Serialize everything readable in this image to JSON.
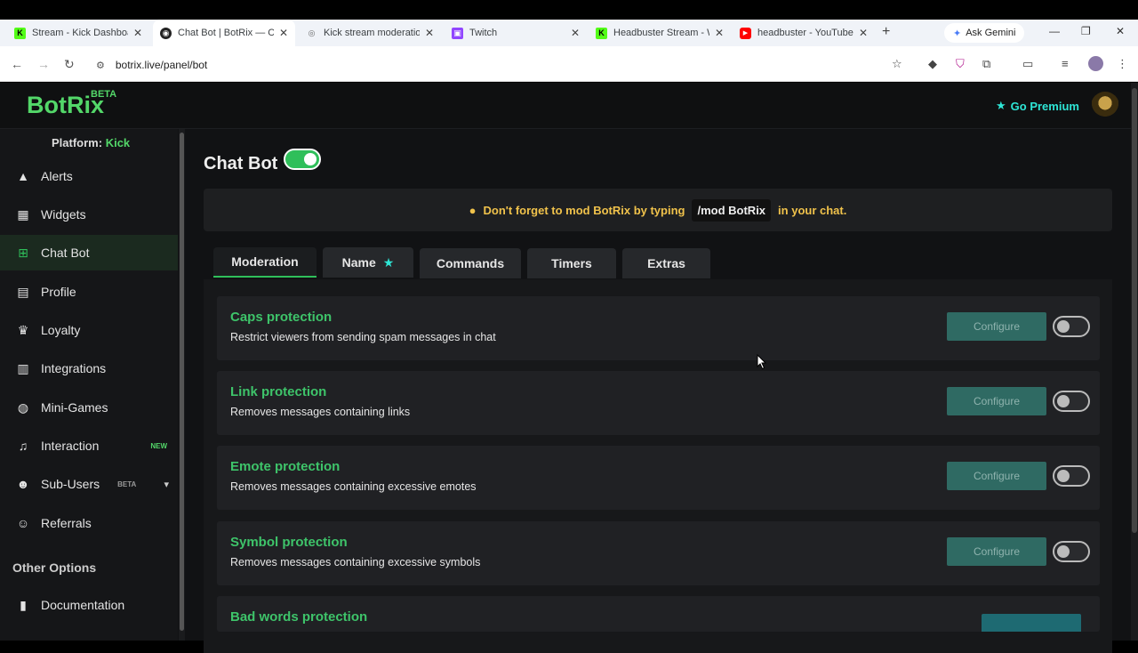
{
  "browser": {
    "tabs": [
      {
        "title": "Stream - Kick Dashboard",
        "icon": "kick-icon",
        "color": "#53fc18"
      },
      {
        "title": "Chat Bot | BotRix — Ch",
        "icon": "botrix-icon",
        "color": "#222222"
      },
      {
        "title": "Kick stream moderation",
        "icon": "globe-icon",
        "color": "#888888"
      },
      {
        "title": "Twitch",
        "icon": "twitch-icon",
        "color": "#9146ff"
      },
      {
        "title": "Headbuster Stream - W",
        "icon": "kick-icon",
        "color": "#53fc18"
      },
      {
        "title": "headbuster - YouTube",
        "icon": "youtube-icon",
        "color": "#ff0000"
      }
    ],
    "gemini_label": "Ask Gemini",
    "url": "botrix.live/panel/bot"
  },
  "header": {
    "logo": "BotRix",
    "logo_badge": "BETA",
    "premium_label": "Go Premium"
  },
  "sidebar": {
    "platform_label": "Platform:",
    "platform_value": "Kick",
    "items": [
      {
        "label": "Alerts",
        "icon": "warning-icon"
      },
      {
        "label": "Widgets",
        "icon": "grid-icon"
      },
      {
        "label": "Chat Bot",
        "icon": "robot-icon"
      },
      {
        "label": "Profile",
        "icon": "id-card-icon"
      },
      {
        "label": "Loyalty",
        "icon": "trophy-icon"
      },
      {
        "label": "Integrations",
        "icon": "puzzle-icon"
      },
      {
        "label": "Mini-Games",
        "icon": "gamepad-icon"
      },
      {
        "label": "Interaction",
        "icon": "music-icon",
        "tag": "NEW"
      },
      {
        "label": "Sub-Users",
        "icon": "users-icon",
        "tag": "BETA"
      },
      {
        "label": "Referrals",
        "icon": "people-icon"
      }
    ],
    "section_title": "Other Options",
    "doc_item": {
      "label": "Documentation",
      "icon": "scroll-icon"
    }
  },
  "main": {
    "title": "Chat Bot",
    "notice": {
      "before": "Don't forget to mod BotRix by typing",
      "code": "/mod BotRix",
      "after": "in your chat."
    },
    "tabs": [
      "Moderation",
      "Name",
      "Commands",
      "Timers",
      "Extras"
    ],
    "configure_label": "Configure",
    "cards": [
      {
        "title": "Caps protection",
        "desc": "Restrict viewers from sending spam messages in chat"
      },
      {
        "title": "Link protection",
        "desc": "Removes messages containing links"
      },
      {
        "title": "Emote protection",
        "desc": "Removes messages containing excessive emotes"
      },
      {
        "title": "Symbol protection",
        "desc": "Removes messages containing excessive symbols"
      },
      {
        "title": "Bad words protection",
        "desc": ""
      }
    ]
  },
  "colors": {
    "accent": "#53d769",
    "premium": "#2ee6d6",
    "notice": "#f0c24b"
  }
}
